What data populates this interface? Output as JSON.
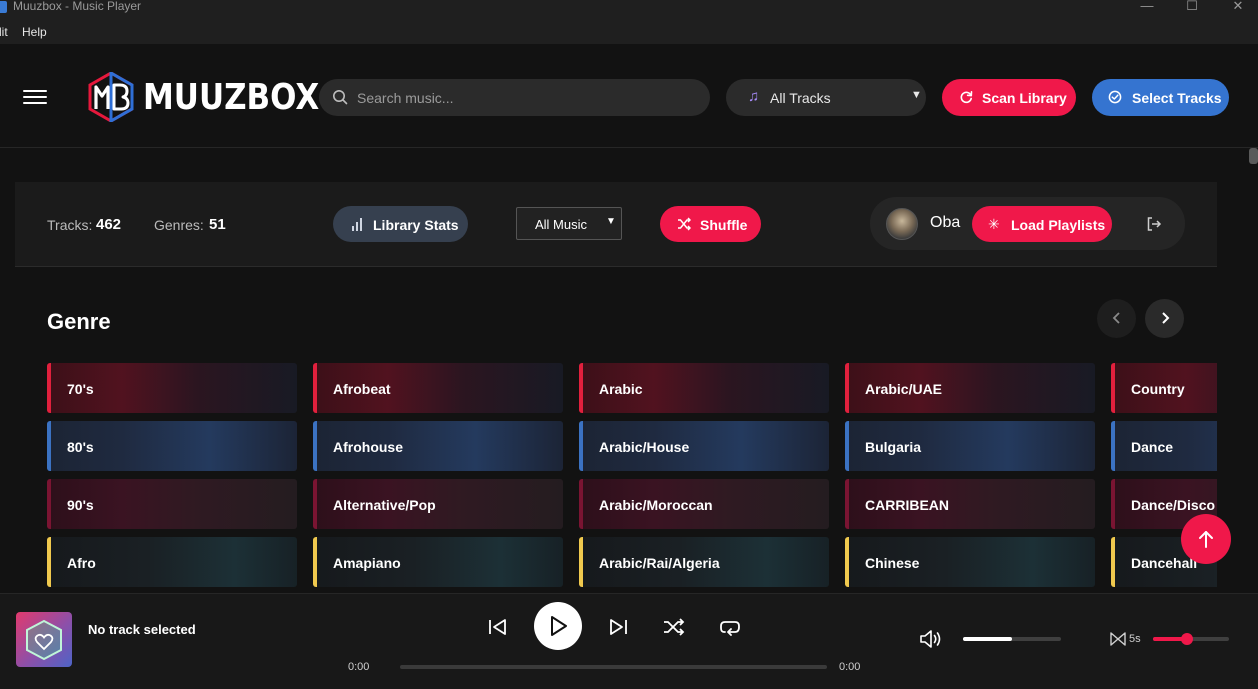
{
  "window": {
    "title": "Muuzbox - Music Player",
    "controls": {
      "minimize": "—",
      "maximize": "☐",
      "close": "✕"
    }
  },
  "menu": [
    "lit",
    "Help"
  ],
  "header": {
    "logo_text": "MUUZBOX",
    "search_placeholder": "Search music...",
    "track_filter": "All Tracks",
    "scan_button": "Scan Library",
    "select_button": "Select Tracks"
  },
  "stats": {
    "tracks_label": "Tracks:",
    "tracks_value": "462",
    "genres_label": "Genres:",
    "genres_value": "51",
    "library_stats_button": "Library Stats",
    "music_filter": "All Music",
    "shuffle_button": "Shuffle",
    "user_name": "Oba",
    "load_playlists_button": "Load Playlists"
  },
  "genre_section": {
    "title": "Genre",
    "columns": [
      [
        "70's",
        "80's",
        "90's",
        "Afro"
      ],
      [
        "Afrobeat",
        "Afrohouse",
        "Alternative/Pop",
        "Amapiano"
      ],
      [
        "Arabic",
        "Arabic/House",
        "Arabic/Moroccan",
        "Arabic/Rai/Algeria"
      ],
      [
        "Arabic/UAE",
        "Bulgaria",
        "CARRIBEAN",
        "Chinese"
      ],
      [
        "Country",
        "Dance",
        "Dance/Disco",
        "Dancehall"
      ]
    ]
  },
  "player": {
    "now_playing": "No track selected",
    "time_current": "0:00",
    "time_total": "0:00",
    "progress": 0,
    "volume": 0.5,
    "crossfade_label": "5s",
    "crossfade_level": 0.45
  },
  "colors": {
    "accent_red": "#f0184a",
    "accent_blue": "#3574d0",
    "background": "#121212"
  }
}
